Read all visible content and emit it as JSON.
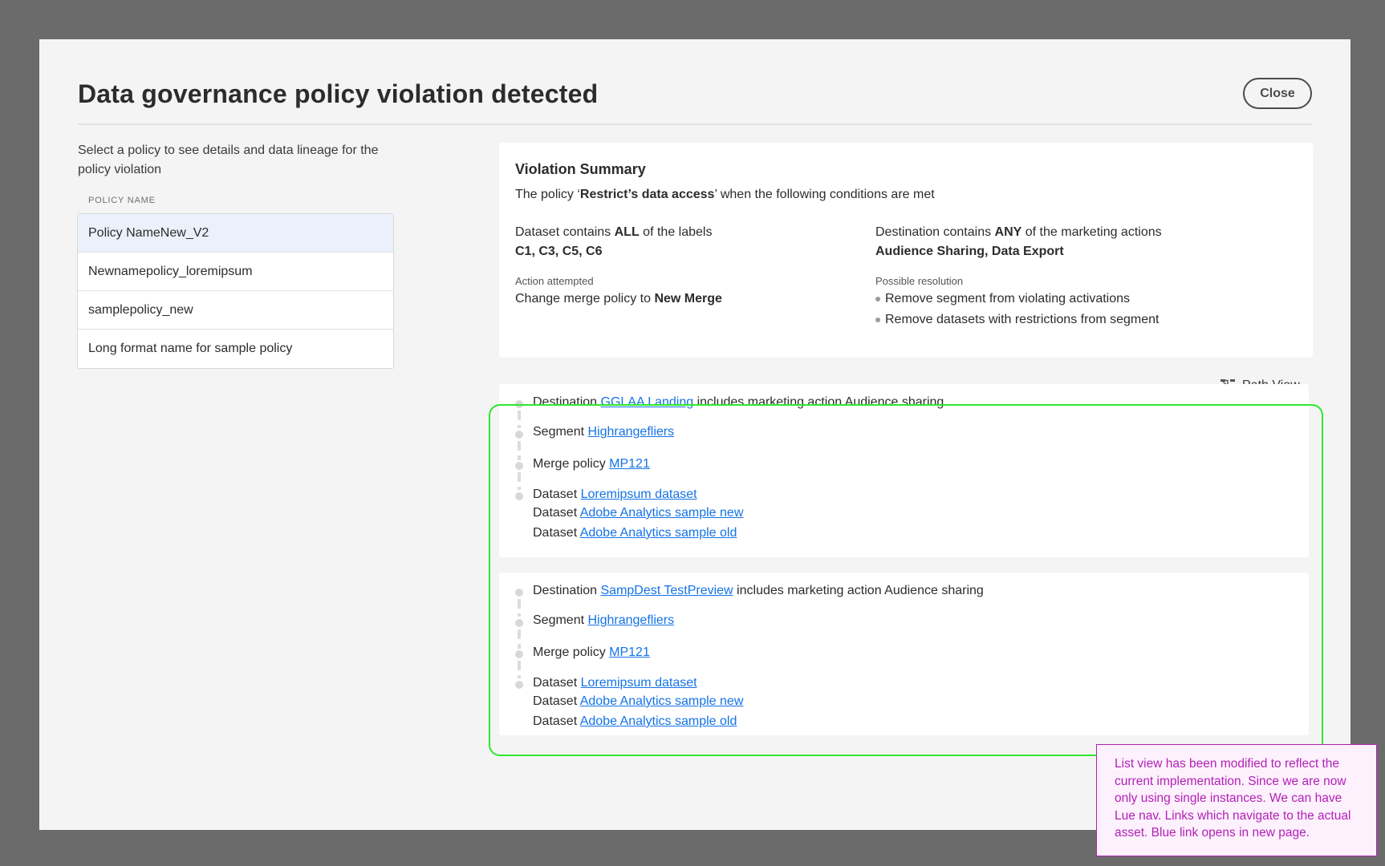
{
  "dialog": {
    "title": "Data governance policy violation detected",
    "close_label": "Close"
  },
  "left": {
    "instruction": "Select a policy to see details and data lineage for the policy violation",
    "column_header": "POLICY NAME",
    "policies": [
      {
        "name": "Policy NameNew_V2",
        "selected": true
      },
      {
        "name": "Newnamepolicy_loremipsum",
        "selected": false
      },
      {
        "name": "samplepolicy_new",
        "selected": false
      },
      {
        "name": "Long format name for sample policy",
        "selected": false
      }
    ]
  },
  "summary": {
    "title": "Violation Summary",
    "policy_prefix": "The policy ‘",
    "policy_name": "Restrict’s data access",
    "policy_suffix": "’ when the following conditions are met",
    "dataset_prefix": "Dataset contains ",
    "dataset_qualifier": "ALL",
    "dataset_suffix": " of the labels",
    "labels": "C1, C3, C5, C6",
    "destination_prefix": "Destination contains ",
    "destination_qualifier": "ANY",
    "destination_suffix": " of the marketing actions",
    "marketing_actions": "Audience Sharing,  Data Export",
    "action_label": "Action attempted",
    "action_prefix": "Change merge policy to ",
    "action_value": "New Merge",
    "resolution_label": "Possible resolution",
    "resolutions": [
      "Remove segment from violating activations",
      "Remove datasets with restrictions from segment"
    ]
  },
  "path_view_label": "Path View",
  "lineage": [
    {
      "destination_prefix": "Destination ",
      "destination_link": "GGLAA  Landing",
      "destination_suffix": " includes marketing action Audience sharing",
      "segment_prefix": "Segment ",
      "segment_link": "Highrangefliers",
      "merge_prefix": "Merge policy ",
      "merge_link": "MP121",
      "dataset_prefix": "Dataset ",
      "datasets": [
        "Loremipsum dataset",
        "Adobe Analytics sample new",
        "Adobe Analytics sample old"
      ]
    },
    {
      "destination_prefix": "Destination ",
      "destination_link": "SampDest  TestPreview",
      "destination_suffix": " includes marketing action Audience sharing",
      "segment_prefix": "Segment ",
      "segment_link": "Highrangefliers",
      "merge_prefix": "Merge policy ",
      "merge_link": "MP121",
      "dataset_prefix": "Dataset ",
      "datasets": [
        "Loremipsum dataset",
        "Adobe Analytics sample new",
        "Adobe Analytics sample old"
      ]
    }
  ],
  "annotation": "List view has been modified to reflect the current implementation.  Since we are now only using single instances. We can have Lue nav. Links which navigate to the actual asset. Blue link opens in new page.",
  "colors": {
    "backdrop": "#6b6b6b",
    "modal_bg": "#f4f4f4",
    "link": "#1473e6",
    "selected_row": "#eaf1fb",
    "highlight_frame": "#2fe82f",
    "annotation": "#b221b6"
  },
  "icons": {
    "path_view": "path-view-icon"
  }
}
